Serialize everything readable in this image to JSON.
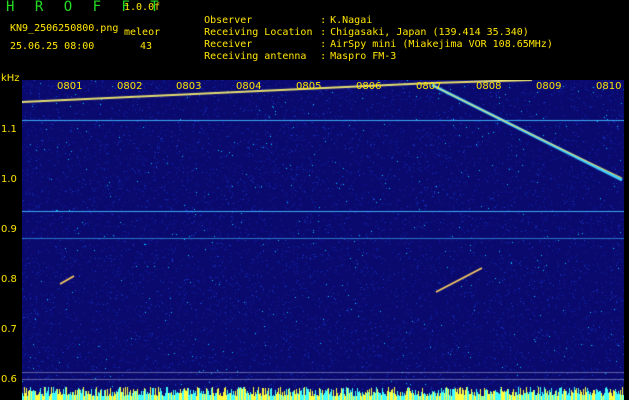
{
  "header": {
    "title": "H R O F F T",
    "fft_size": "1.0.0f",
    "filename": "KN9_2506250800.png",
    "timestamp": "25.06.25 08:00",
    "mode": "meleor",
    "count": "43"
  },
  "info": [
    {
      "label": "Observer",
      "value": "K.Nagai"
    },
    {
      "label": "Receiving Location",
      "value": "Chigasaki, Japan (139.414 35.340)"
    },
    {
      "label": "Receiver",
      "value": "AirSpy mini (Miakejima VOR 108.65MHz)"
    },
    {
      "label": "Receiving antenna",
      "value": "Maspro FM-3"
    }
  ],
  "axis": {
    "unit": "kHz",
    "ylabels": [
      "1.1",
      "1.0",
      "0.9",
      "0.8",
      "0.7",
      "0.6"
    ],
    "xlabels": [
      "0801",
      "0802",
      "0803",
      "0804",
      "0805",
      "0806",
      "0807",
      "0808",
      "0809",
      "0810"
    ]
  },
  "colors": {
    "background": "#0a0a6e",
    "text": "#ffe600",
    "title": "#22dd22",
    "signal": "#00e0ff"
  }
}
